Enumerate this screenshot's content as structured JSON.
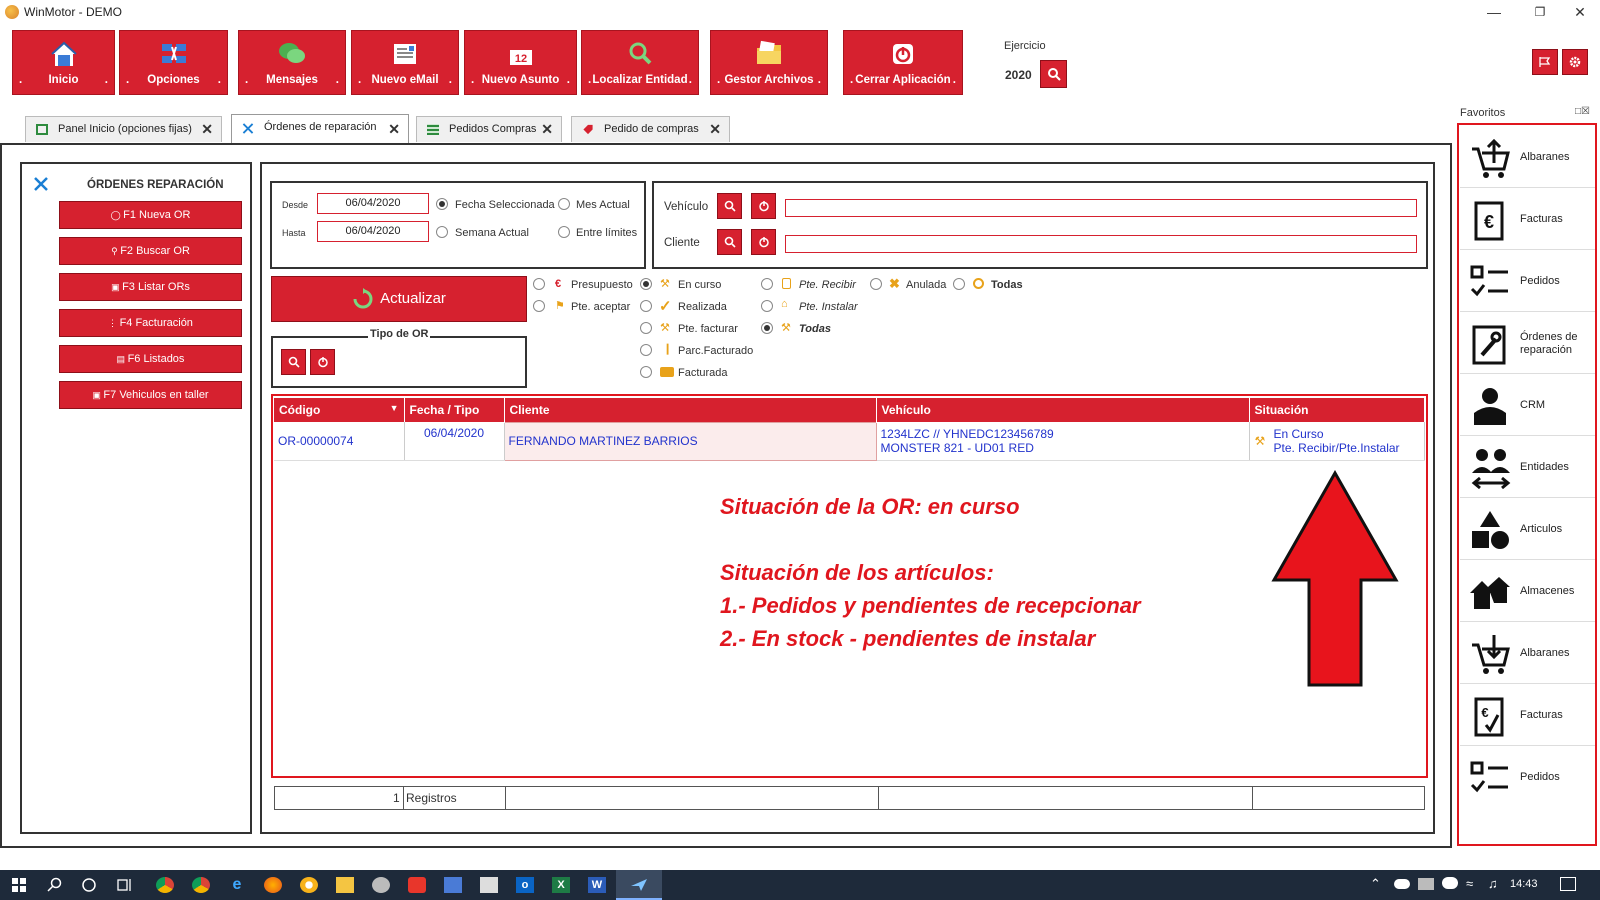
{
  "window": {
    "title": "WinMotor - DEMO"
  },
  "toolbar": {
    "buttons": [
      {
        "label": "Inicio"
      },
      {
        "label": "Opciones"
      },
      {
        "label": "Mensajes"
      },
      {
        "label": "Nuevo eMail"
      },
      {
        "label": "Nuevo Asunto"
      },
      {
        "label": "Localizar Entidad"
      },
      {
        "label": "Gestor Archivos"
      },
      {
        "label": "Cerrar Aplicación"
      }
    ],
    "ejercicio_label": "Ejercicio",
    "ejercicio_value": "2020"
  },
  "tabs": [
    {
      "label": "Panel Inicio (opciones fijas)"
    },
    {
      "label": "Órdenes de reparación"
    },
    {
      "label": "Pedidos Compras"
    },
    {
      "label": "Pedido de compras"
    }
  ],
  "left_panel": {
    "title": "ÓRDENES REPARACIÓN",
    "buttons": [
      {
        "label": "F1 Nueva OR"
      },
      {
        "label": "F2 Buscar OR"
      },
      {
        "label": "F3 Listar ORs"
      },
      {
        "label": "F4 Facturación"
      },
      {
        "label": "F6 Listados"
      },
      {
        "label": "F7 Vehiculos en taller"
      }
    ]
  },
  "filters": {
    "desde_label": "Desde",
    "desde_value": "06/04/2020",
    "hasta_label": "Hasta",
    "hasta_value": "06/04/2020",
    "date_options": [
      {
        "label": "Fecha Seleccionada",
        "selected": true
      },
      {
        "label": "Mes Actual",
        "selected": false
      },
      {
        "label": "Semana Actual",
        "selected": false
      },
      {
        "label": "Entre límites",
        "selected": false
      }
    ],
    "vehiculo_label": "Vehículo",
    "cliente_label": "Cliente",
    "actualizar_label": "Actualizar",
    "tipo_or_label": "Tipo de OR"
  },
  "status_options": {
    "col1": [
      {
        "label": "Presupuesto"
      },
      {
        "label": "Pte. aceptar"
      }
    ],
    "col2": [
      {
        "label": "En curso",
        "selected": true
      },
      {
        "label": "Realizada"
      },
      {
        "label": "Pte. facturar"
      },
      {
        "label": "Parc.Facturado"
      },
      {
        "label": "Facturada"
      }
    ],
    "col3": [
      {
        "label": "Pte. Recibir"
      },
      {
        "label": "Pte. Instalar"
      },
      {
        "label": "Todas",
        "selected": true
      }
    ],
    "col4": [
      {
        "label": "Anulada"
      },
      {
        "label": "Todas"
      }
    ]
  },
  "grid": {
    "columns": [
      "Código",
      "Fecha / Tipo",
      "Cliente",
      "Vehículo",
      "Situación"
    ],
    "rows": [
      {
        "codigo": "OR-00000074",
        "fecha": "06/04/2020",
        "cliente": "FERNANDO MARTINEZ BARRIOS",
        "vehiculo_line1": "1234LZC   //   YHNEDC123456789",
        "vehiculo_line2": "MONSTER 821 - UD01 RED",
        "situacion_line1": "En Curso",
        "situacion_line2": "Pte. Recibir/Pte.Instalar"
      }
    ],
    "footer_count": "1",
    "footer_label": "Registros"
  },
  "annotation": {
    "line1": "Situación de la OR: en curso",
    "line2": "Situación de los artículos:",
    "line3": "1.- Pedidos y pendientes de recepcionar",
    "line4": "2.- En stock - pendientes de instalar"
  },
  "favorites": {
    "title": "Favoritos",
    "items": [
      {
        "label": "Albaranes",
        "icon": "cart-up-icon"
      },
      {
        "label": "Facturas",
        "icon": "invoice-euro-icon"
      },
      {
        "label": "Pedidos",
        "icon": "checklist-icon"
      },
      {
        "label": "Órdenes de reparación",
        "icon": "wrench-doc-icon"
      },
      {
        "label": "CRM",
        "icon": "person-icon"
      },
      {
        "label": "Entidades",
        "icon": "people-exchange-icon"
      },
      {
        "label": "Articulos",
        "icon": "shapes-icon"
      },
      {
        "label": "Almacenes",
        "icon": "houses-icon"
      },
      {
        "label": "Albaranes",
        "icon": "cart-down-icon"
      },
      {
        "label": "Facturas",
        "icon": "invoice-check-icon"
      },
      {
        "label": "Pedidos",
        "icon": "checklist-icon"
      }
    ]
  },
  "taskbar": {
    "time": "14:43"
  },
  "colors": {
    "accent": "#d6212f",
    "link": "#2233cc",
    "annotation": "#e0161e"
  }
}
